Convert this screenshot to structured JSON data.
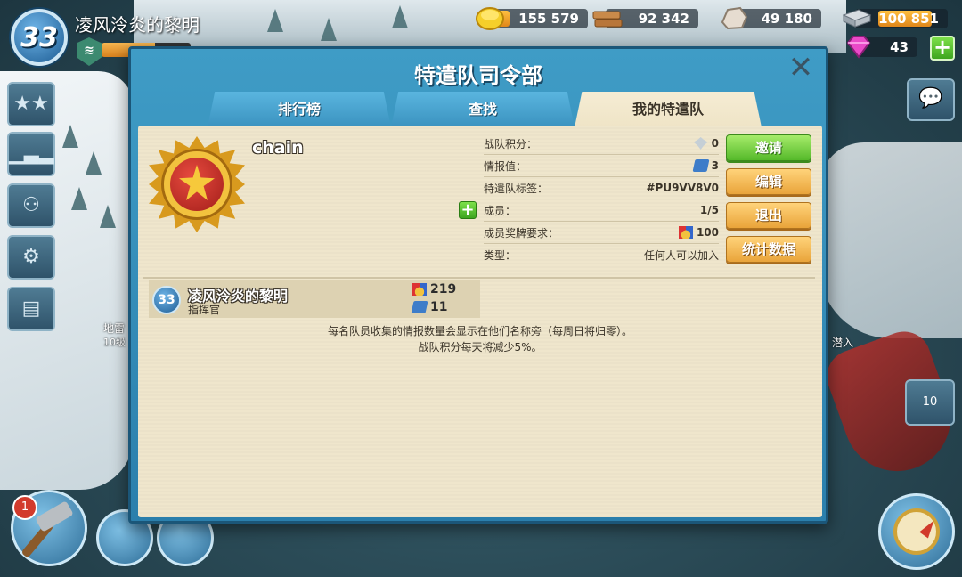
{
  "hud": {
    "level": "33",
    "player_name": "凌风泠炎的黎明",
    "xp_progress": 0.6
  },
  "resources": {
    "gold": "155 579",
    "wood": "92 342",
    "stone": "49 180",
    "iron": "100 851",
    "gems": "43",
    "add_gems_label": "+"
  },
  "world": {
    "hammer_badge": "1",
    "right_button_label": "10",
    "left_label": "地雷",
    "left_sublabel": "10级",
    "right_label": "潜入"
  },
  "modal": {
    "title": "特遣队司令部",
    "close_label": "✕",
    "tabs": [
      "排行榜",
      "查找",
      "我的特遣队"
    ],
    "active_tab": 2,
    "team": {
      "name": "chain",
      "stats": [
        {
          "label": "战队积分：",
          "value": "0",
          "icon": "wing-icon"
        },
        {
          "label": "情报值：",
          "value": "3",
          "icon": "intel-icon"
        },
        {
          "label": "特遣队标签：",
          "value": "#PU9VV8V0",
          "icon": ""
        },
        {
          "label": "成员：",
          "value": "1/5",
          "icon": ""
        },
        {
          "label": "成员奖牌要求：",
          "value": "100",
          "icon": "medal-icon"
        },
        {
          "label": "类型：",
          "value": "任何人可以加入",
          "icon": ""
        }
      ],
      "add_member_label": "+"
    },
    "buttons": {
      "invite": "邀请",
      "edit": "编辑",
      "quit": "退出",
      "stats": "统计数据"
    },
    "members": [
      {
        "level": "33",
        "name": "凌风泠炎的黎明",
        "role": "指挥官",
        "medals": "219",
        "intel": "11"
      }
    ],
    "info_line1": "每名队员收集的情报数量会显示在他们名称旁（每周日将归零）。",
    "info_line2": "战队积分每天将减少5%。"
  },
  "colors": {
    "modal_blue": "#3f9cc6",
    "panel_beige": "#efe6cc",
    "invite_green": "#55b92a",
    "button_orange": "#e9a43a"
  }
}
